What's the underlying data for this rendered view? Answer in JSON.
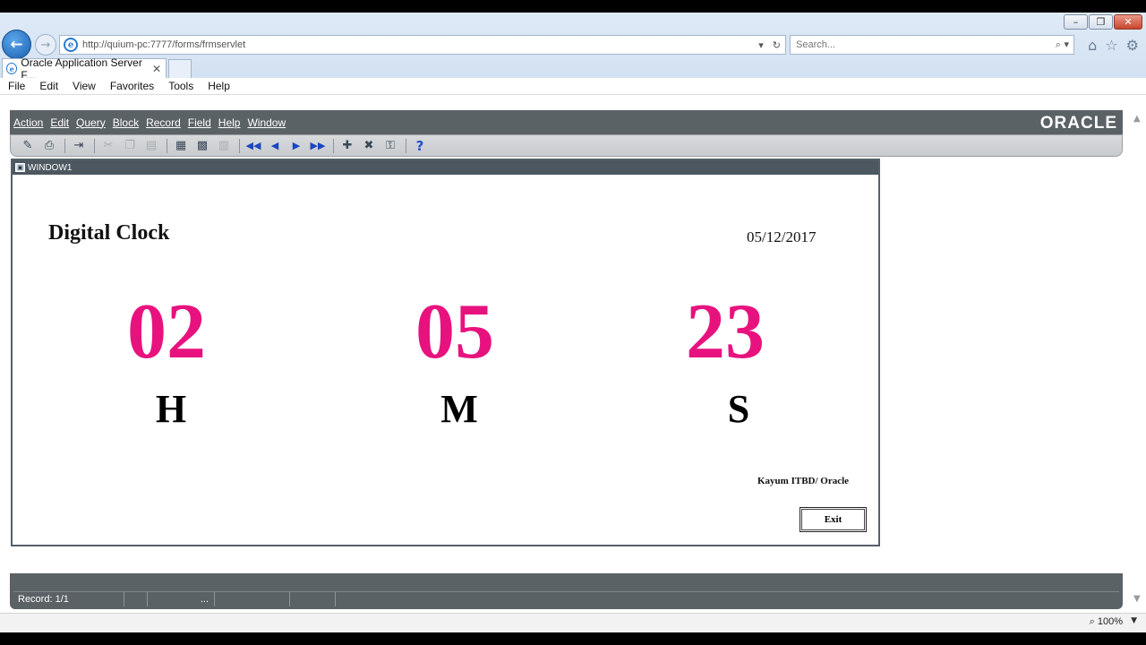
{
  "browser": {
    "address": "http://quium-pc:7777/forms/frmservlet",
    "search_placeholder": "Search...",
    "tab_title": "Oracle Application Server F...",
    "menu": [
      "File",
      "Edit",
      "View",
      "Favorites",
      "Tools",
      "Help"
    ],
    "zoom": "100%"
  },
  "forms": {
    "menu": [
      "Action",
      "Edit",
      "Query",
      "Block",
      "Record",
      "Field",
      "Help",
      "Window"
    ],
    "logo": "ORACLE",
    "window_title": "WINDOW1"
  },
  "clock": {
    "title": "Digital Clock",
    "date": "05/12/2017",
    "hours": "02",
    "minutes": "05",
    "seconds": "23",
    "hours_label": "H",
    "minutes_label": "M",
    "seconds_label": "S",
    "credit": "Kayum ITBD/ Oracle",
    "exit_label": "Exit",
    "digit_color": "#e8127f"
  },
  "status": {
    "record": "Record: 1/1",
    "ellipsis": "..."
  }
}
